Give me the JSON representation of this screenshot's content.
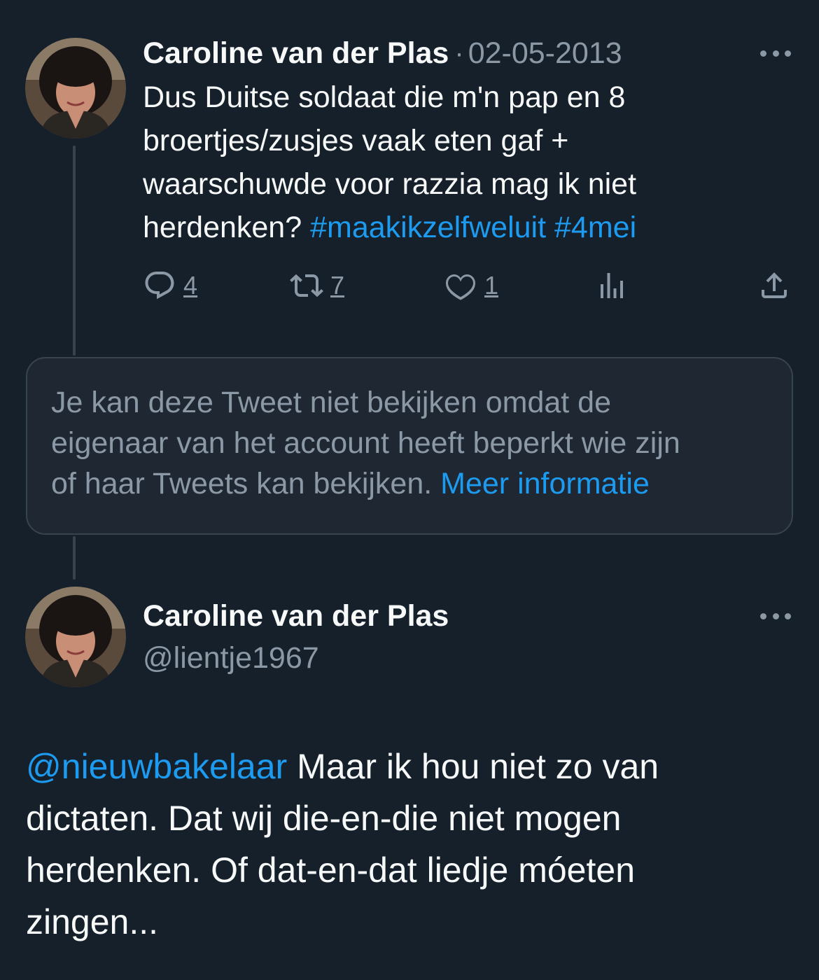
{
  "tweet1": {
    "author_name": "Caroline van der Plas",
    "separator": "·",
    "date": "02-05-2013",
    "text_lines": [
      "Dus Duitse soldaat die m'n pap en 8",
      "broertjes/zusjes vaak eten gaf +",
      "waarschuwde voor razzia mag ik niet",
      "herdenken?"
    ],
    "hashtags": [
      "#maakikzelfweluit",
      "#4mei"
    ],
    "actions": {
      "reply": {
        "icon": "reply-icon",
        "count": "4"
      },
      "retweet": {
        "icon": "retweet-icon",
        "count": "7"
      },
      "like": {
        "icon": "heart-icon",
        "count": "1"
      },
      "views": {
        "icon": "views-icon"
      },
      "share": {
        "icon": "share-icon"
      }
    }
  },
  "restricted_notice": {
    "lines": [
      "Je kan deze Tweet niet bekijken omdat de",
      "eigenaar van het account heeft beperkt wie zijn",
      "of haar Tweets kan bekijken."
    ],
    "link": "Meer informatie"
  },
  "tweet2": {
    "author_name": "Caroline van der Plas",
    "handle": "@lientje1967",
    "mention": "@nieuwbakelaar",
    "text_lines": [
      "Maar ik hou niet zo van",
      "dictaten. Dat wij die-en-die niet mogen",
      "herdenken. Of dat-en-dat liedje móeten",
      "zingen..."
    ]
  },
  "colors": {
    "background": "#15202b",
    "text_primary": "#f7f9f9",
    "text_secondary": "#8b98a5",
    "accent": "#1d9bf0",
    "border": "#38444d",
    "card_background": "#1e2732"
  }
}
